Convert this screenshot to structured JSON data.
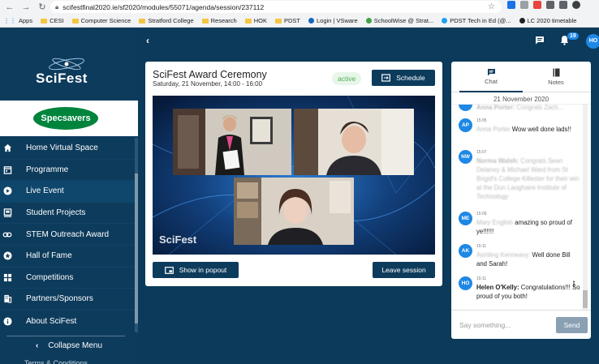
{
  "browser": {
    "url": "scifestfinal2020.ie/sf2020/modules/55071/agenda/session/237112",
    "bookmarks": [
      {
        "label": "Apps",
        "type": "apps"
      },
      {
        "label": "CESI",
        "type": "folder"
      },
      {
        "label": "Computer Science",
        "type": "folder"
      },
      {
        "label": "Stratford College",
        "type": "folder"
      },
      {
        "label": "Research",
        "type": "folder"
      },
      {
        "label": "HOK",
        "type": "folder"
      },
      {
        "label": "PDST",
        "type": "folder"
      },
      {
        "label": "Login | VSware",
        "type": "site"
      },
      {
        "label": "SchoolWise @ Strat...",
        "type": "site"
      },
      {
        "label": "PDST Tech in Ed (@...",
        "type": "site"
      },
      {
        "label": "LC 2020 timetable",
        "type": "site"
      }
    ]
  },
  "sidebar": {
    "logo": "SciFest",
    "sponsor": "Specsavers",
    "items": [
      {
        "label": "Home Virtual Space",
        "icon": "home-icon"
      },
      {
        "label": "Programme",
        "icon": "calendar-icon"
      },
      {
        "label": "Live Event",
        "icon": "play-icon"
      },
      {
        "label": "Student Projects",
        "icon": "projects-icon"
      },
      {
        "label": "STEM Outreach Award",
        "icon": "link-icon"
      },
      {
        "label": "Hall of Fame",
        "icon": "star-icon"
      },
      {
        "label": "Competitions",
        "icon": "grid-icon"
      },
      {
        "label": "Partners/Sponsors",
        "icon": "building-icon"
      },
      {
        "label": "About SciFest",
        "icon": "info-icon"
      }
    ],
    "collapse_label": "Collapse Menu",
    "cutoff_text": "Terms & Conditions"
  },
  "topbar": {
    "notification_count": "19",
    "user_initials": "HO"
  },
  "session": {
    "title": "SciFest Award Ceremony",
    "subtitle": "Saturday, 21 November, 14:00 - 16:00",
    "status": "active",
    "schedule_label": "Schedule",
    "video_watermark": "SciFest",
    "popout_label": "Show in popout",
    "leave_label": "Leave session"
  },
  "chat": {
    "tab_chat": "Chat",
    "tab_notes": "Notes",
    "date": "21 November 2020",
    "messages": [
      {
        "initials": "",
        "time": "",
        "author": "Anna Porter:",
        "text": " Congrats Zach..."
      },
      {
        "initials": "AP",
        "time": "15:05",
        "author": "Anna Porter",
        "text": " Wow well done lads!!"
      },
      {
        "initials": "NW",
        "time": "15:07",
        "author": "Norma Walsh:",
        "text": " Congrats Sean Delaney & Michael Ward from St Brigid's College Killester for their win at the Dun Laoghaire Institute of Technology"
      },
      {
        "initials": "ME",
        "time": "15:09",
        "author": "Mary English",
        "text": " amazing so proud of ye!!!!!!"
      },
      {
        "initials": "AK",
        "time": "15:11",
        "author": "Aishling Kenneavy:",
        "text": " Well done Bill and Sarah!"
      },
      {
        "initials": "HO",
        "time": "15:11",
        "author": "Helen O'Kelly:",
        "text": " Congratulations!!! So proud of you both!"
      }
    ],
    "input_placeholder": "Say something...",
    "send_label": "Send"
  }
}
